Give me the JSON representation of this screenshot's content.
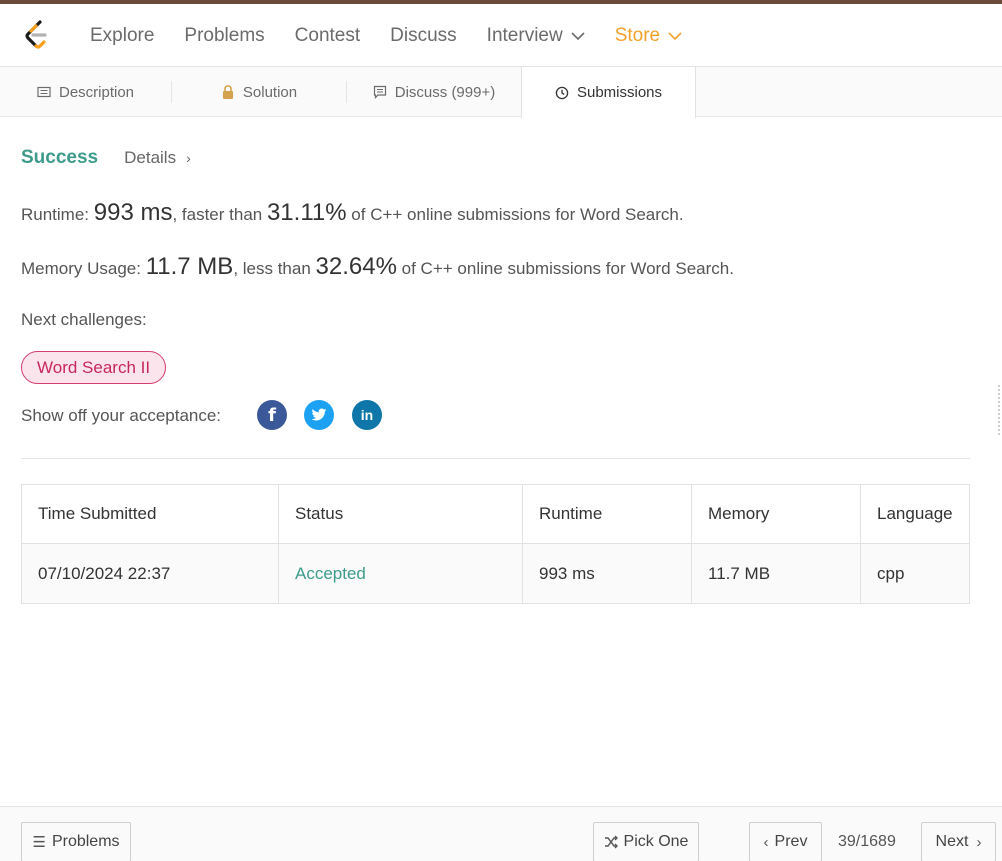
{
  "nav": {
    "items": [
      "Explore",
      "Problems",
      "Contest",
      "Discuss",
      "Interview"
    ],
    "store": "Store"
  },
  "tabs": [
    {
      "label": "Description",
      "icon": "description-icon"
    },
    {
      "label": "Solution",
      "icon": "lock-icon"
    },
    {
      "label": "Discuss (999+)",
      "icon": "comment-icon"
    },
    {
      "label": "Submissions",
      "icon": "clock-icon"
    }
  ],
  "result": {
    "status": "Success",
    "details": "Details",
    "runtime_label": "Runtime: ",
    "runtime_value": "993 ms",
    "runtime_mid": ", faster than ",
    "runtime_pct": "31.11%",
    "runtime_tail": " of C++ online submissions for Word Search.",
    "memory_label": "Memory Usage: ",
    "memory_value": "11.7 MB",
    "memory_mid": ", less than ",
    "memory_pct": "32.64%",
    "memory_tail": " of C++ online submissions for Word Search.",
    "next_label": "Next challenges:",
    "challenge": "Word Search II",
    "share_label": "Show off your acceptance:"
  },
  "table": {
    "headers": [
      "Time Submitted",
      "Status",
      "Runtime",
      "Memory",
      "Language"
    ],
    "row": [
      "07/10/2024 22:37",
      "Accepted",
      "993 ms",
      "11.7 MB",
      "cpp"
    ]
  },
  "footer": {
    "problems": "Problems",
    "pick_one": "Pick One",
    "prev": "Prev",
    "pager": "39/1689",
    "next": "Next"
  },
  "colors": {
    "accent_teal": "#3e9b8b",
    "store_orange": "#f3a02b",
    "challenge_pink": "#c7275f"
  }
}
